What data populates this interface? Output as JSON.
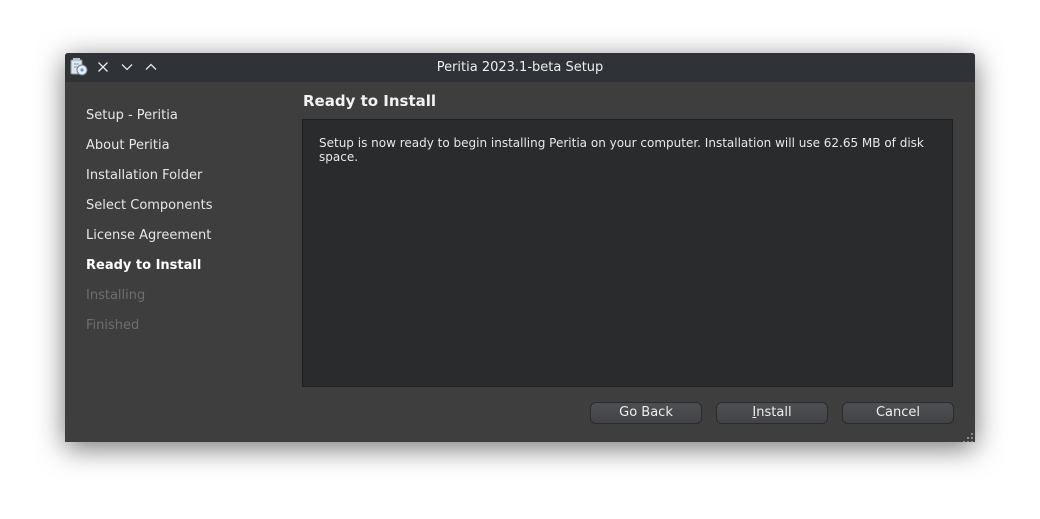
{
  "window": {
    "title": "Peritia 2023.1-beta Setup",
    "icons": {
      "app": "installer-app-icon",
      "close": "close-icon",
      "minimize": "chevron-down-icon",
      "maximize": "chevron-up-icon"
    }
  },
  "sidebar": {
    "steps": [
      {
        "label": "Setup - Peritia",
        "state": "done"
      },
      {
        "label": "About Peritia",
        "state": "done"
      },
      {
        "label": "Installation Folder",
        "state": "done"
      },
      {
        "label": "Select Components",
        "state": "done"
      },
      {
        "label": "License Agreement",
        "state": "done"
      },
      {
        "label": "Ready to Install",
        "state": "current"
      },
      {
        "label": "Installing",
        "state": "future"
      },
      {
        "label": "Finished",
        "state": "future"
      }
    ]
  },
  "page": {
    "title": "Ready to Install",
    "message": "Setup is now ready to begin installing Peritia on your computer. Installation will use 62.65 MB of disk space."
  },
  "buttons": {
    "go_back": "Go Back",
    "install_mnemonic": "I",
    "install_rest": "nstall",
    "cancel": "Cancel"
  },
  "colors": {
    "window_bg": "#3e3e3e",
    "titlebar_bg": "#2f3236",
    "content_bg": "#2a2b2d",
    "text": "#e6e6e6",
    "disabled_text": "#6e6e6e"
  }
}
